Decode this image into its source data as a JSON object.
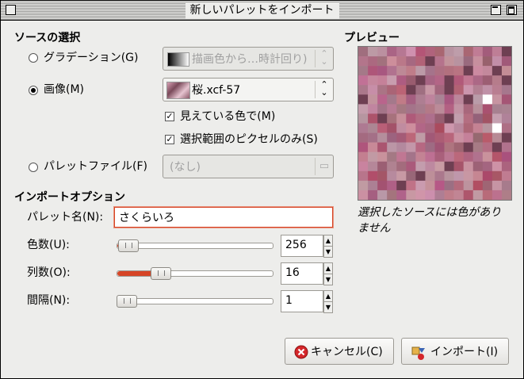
{
  "window": {
    "title": "新しいパレットをインポート"
  },
  "source": {
    "header": "ソースの選択",
    "gradient": {
      "label": "グラデーション(G)",
      "value": "描画色から…時計回り)"
    },
    "image": {
      "label": "画像(M)",
      "value": "桜.xcf-57"
    },
    "visible_colors": {
      "label": "見えている色で(M)"
    },
    "selection_only": {
      "label": "選択範囲のピクセルのみ(S)"
    },
    "palette_file": {
      "label": "パレットファイル(F)",
      "value": "(なし)"
    }
  },
  "options": {
    "header": "インポートオプション",
    "name_label": "パレット名(N):",
    "name_value": "さくらいろ",
    "colors_label": "色数(U):",
    "colors_value": "256",
    "columns_label": "列数(O):",
    "columns_value": "16",
    "interval_label": "間隔(N):",
    "interval_value": "1"
  },
  "preview": {
    "header": "プレビュー",
    "message": "選択したソースには色がありません"
  },
  "buttons": {
    "cancel": "キャンセル(C)",
    "import": "インポート(I)"
  },
  "colors": {
    "accent": "#d64526",
    "preview_base": "#a56b83"
  }
}
